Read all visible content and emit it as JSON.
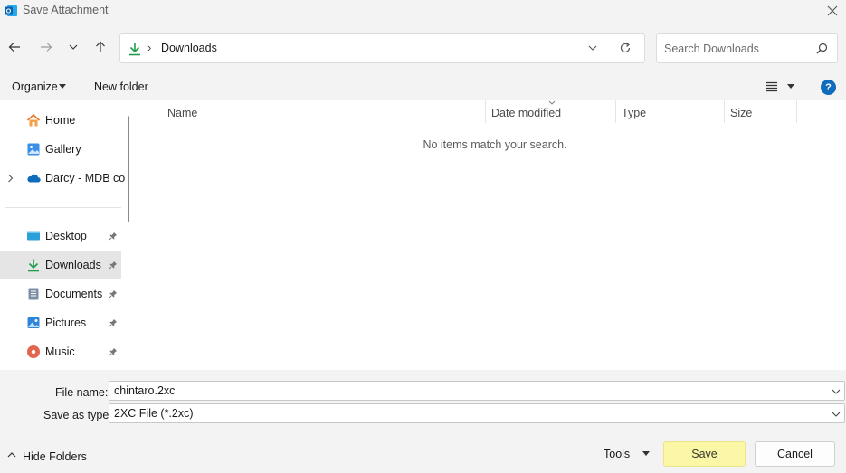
{
  "window": {
    "title": "Save Attachment",
    "icon": "outlook-app-icon"
  },
  "nav": {
    "address_folder": "Downloads",
    "address_separator": "›",
    "search_placeholder": "Search Downloads"
  },
  "commands": {
    "organize": "Organize",
    "new_folder": "New folder",
    "help": "?"
  },
  "sidebar": {
    "items": [
      {
        "label": "Home",
        "icon": "home-icon"
      },
      {
        "label": "Gallery",
        "icon": "gallery-icon"
      },
      {
        "label": "Darcy - MDB co",
        "icon": "onedrive-cloud-icon"
      },
      {
        "label": "Desktop",
        "icon": "desktop-icon"
      },
      {
        "label": "Downloads",
        "icon": "download-icon"
      },
      {
        "label": "Documents",
        "icon": "documents-icon"
      },
      {
        "label": "Pictures",
        "icon": "pictures-icon"
      },
      {
        "label": "Music",
        "icon": "music-icon"
      }
    ]
  },
  "columns": [
    "Name",
    "Date modified",
    "Type",
    "Size"
  ],
  "content": {
    "empty_message": "No items match your search."
  },
  "fields": {
    "file_name_label": "File name:",
    "file_name_value": "chintaro.2xc",
    "save_type_label": "Save as type:",
    "save_type_value": "2XC File (*.2xc)"
  },
  "footer": {
    "hide_folders": "Hide Folders",
    "tools": "Tools",
    "save": "Save",
    "cancel": "Cancel"
  },
  "colors": {
    "accent": "#0f6cbd",
    "save_highlight": "#fbf7a7",
    "download_green": "#1e9e4a"
  }
}
